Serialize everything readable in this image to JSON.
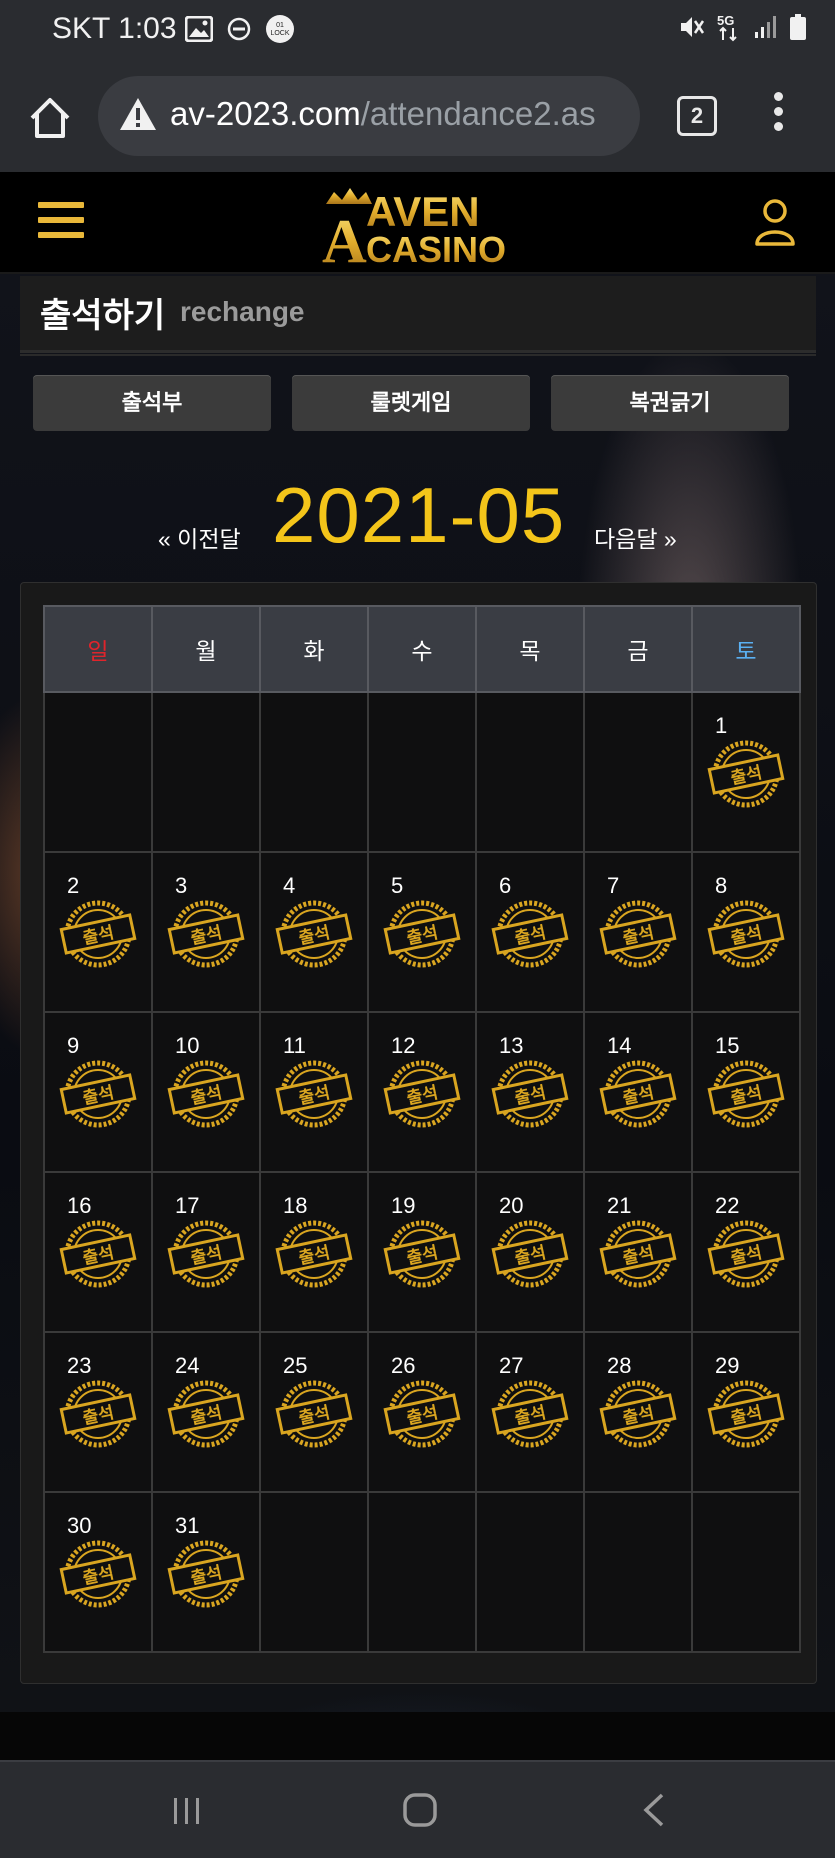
{
  "status_bar": {
    "carrier_time": "SKT 1:03",
    "left_icons": [
      "gallery-icon",
      "dnd-icon",
      "lock-badge-icon"
    ],
    "right_icons": [
      "mute-icon",
      "5g-icon",
      "signal-icon",
      "battery-icon"
    ],
    "lock_badge_text": "01 LOCK",
    "network_label": "5G"
  },
  "browser": {
    "url_host": "av-2023.com",
    "url_path": "/attendance2.as",
    "tab_count": "2"
  },
  "site": {
    "logo_line1": "AVEN",
    "logo_line2": "CASINO",
    "brand_color": "#e9b83a"
  },
  "page": {
    "title": "출석하기",
    "subtitle": "rechange"
  },
  "tabs": [
    {
      "label": "출석부"
    },
    {
      "label": "룰렛게임"
    },
    {
      "label": "복권긁기"
    }
  ],
  "calendar": {
    "prev_label": "« 이전달",
    "month": "2021-05",
    "next_label": "다음달 »",
    "weekdays": [
      "일",
      "월",
      "화",
      "수",
      "목",
      "금",
      "토"
    ],
    "stamp_text": "출석",
    "weeks": [
      [
        null,
        null,
        null,
        null,
        null,
        null,
        "1"
      ],
      [
        "2",
        "3",
        "4",
        "5",
        "6",
        "7",
        "8"
      ],
      [
        "9",
        "10",
        "11",
        "12",
        "13",
        "14",
        "15"
      ],
      [
        "16",
        "17",
        "18",
        "19",
        "20",
        "21",
        "22"
      ],
      [
        "23",
        "24",
        "25",
        "26",
        "27",
        "28",
        "29"
      ],
      [
        "30",
        "31",
        null,
        null,
        null,
        null,
        null
      ]
    ],
    "attended_days": [
      "1",
      "2",
      "3",
      "4",
      "5",
      "6",
      "7",
      "8",
      "9",
      "10",
      "11",
      "12",
      "13",
      "14",
      "15",
      "16",
      "17",
      "18",
      "19",
      "20",
      "21",
      "22",
      "23",
      "24",
      "25",
      "26",
      "27",
      "28",
      "29",
      "30",
      "31"
    ],
    "colors": {
      "sunday": "#e0242b",
      "saturday": "#5ab0f2",
      "month": "#f4c51a",
      "stamp": "#d9a520"
    }
  },
  "nav": {
    "icons": [
      "recent-apps-icon",
      "home-icon",
      "back-icon"
    ]
  }
}
